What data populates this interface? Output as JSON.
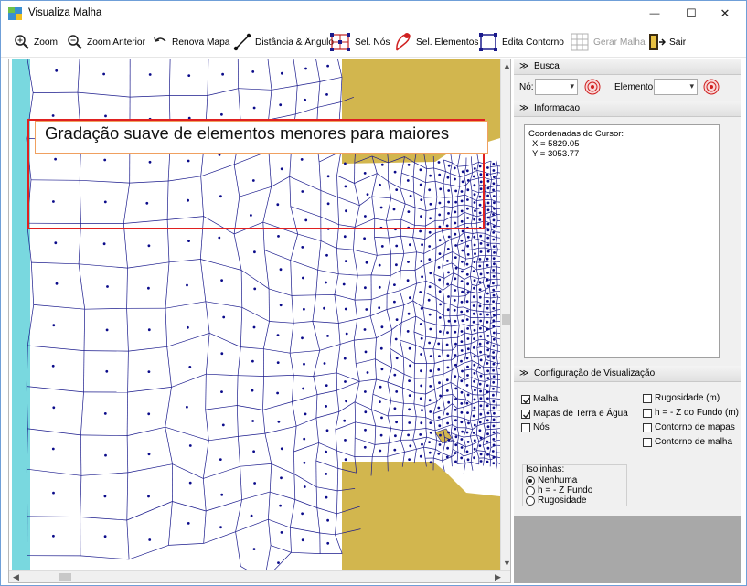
{
  "window": {
    "title": "Visualiza Malha",
    "controls": {
      "minimize": "—",
      "maximize": "☐",
      "close": "✕"
    }
  },
  "toolbar": {
    "zoom": "Zoom",
    "zoom_anterior": "Zoom Anterior",
    "renova_mapa": "Renova Mapa",
    "distancia_angulo": "Distância & Ângulo",
    "sel_nos": "Sel. Nós",
    "sel_elementos": "Sel. Elementos",
    "edita_contorno": "Edita Contorno",
    "gerar_malha": "Gerar Malha",
    "sair": "Sair"
  },
  "annotation": {
    "text": "Gradação suave de elementos menores para maiores"
  },
  "busca": {
    "header": "Busca",
    "no_label": "Nó:",
    "elemento_label": "Elemento:"
  },
  "informacao": {
    "header": "Informacao",
    "cursor_title": "Coordenadas do Cursor:",
    "x": "X = 5829.05",
    "y": "Y = 3053.77"
  },
  "config": {
    "header": "Configuração de Visualização",
    "checks": [
      {
        "label": "Malha",
        "checked": true
      },
      {
        "label": "Mapas de Terra e Água",
        "checked": true
      },
      {
        "label": "Nós",
        "checked": false
      },
      {
        "label": "Rugosidade (m)",
        "checked": false
      },
      {
        "label": "h = - Z do Fundo (m)",
        "checked": false
      },
      {
        "label": "Contorno de mapas",
        "checked": false
      },
      {
        "label": "Contorno de malha",
        "checked": false
      }
    ],
    "isolinhas": {
      "title": "Isolinhas:",
      "options": [
        {
          "label": "Nenhuma",
          "selected": true
        },
        {
          "label": "h = - Z Fundo",
          "selected": false
        },
        {
          "label": "Rugosidade",
          "selected": false
        }
      ]
    }
  },
  "colors": {
    "water": "#79d8df",
    "land": "#d2b64e",
    "mesh": "#1a1a8c",
    "node": "#0b0b8a",
    "callout_red": "#e02020",
    "panel_grey": "#a8a8a8"
  }
}
